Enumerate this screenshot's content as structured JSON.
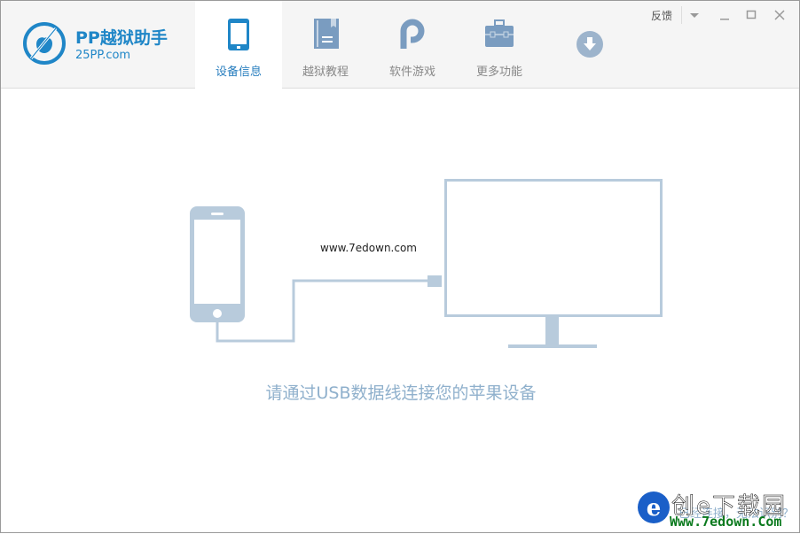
{
  "app": {
    "name": "PP越狱助手",
    "domain": "25PP.com"
  },
  "tabs": [
    {
      "label": "设备信息",
      "icon": "phone-icon",
      "active": true
    },
    {
      "label": "越狱教程",
      "icon": "book-icon",
      "active": false
    },
    {
      "label": "软件游戏",
      "icon": "pp-icon",
      "active": false
    },
    {
      "label": "更多功能",
      "icon": "toolbox-icon",
      "active": false
    }
  ],
  "download_icon": "download-icon",
  "window_controls": {
    "feedback": "反馈",
    "menu": "chevron-down-icon",
    "minimize": "minimize-icon",
    "maximize": "maximize-icon",
    "close": "close-icon"
  },
  "main": {
    "message": "请通过USB数据线连接您的苹果设备",
    "hidden_link": "已经连接，无法识别？"
  },
  "watermark": {
    "text": "www.7edown.com",
    "logo_text": "创e下载园 Www.7edown.Com"
  },
  "colors": {
    "accent": "#1f86c7",
    "illustration": "#b8cbdc",
    "message": "#8fb0cc",
    "icon_inactive": "#7a9cc0"
  }
}
